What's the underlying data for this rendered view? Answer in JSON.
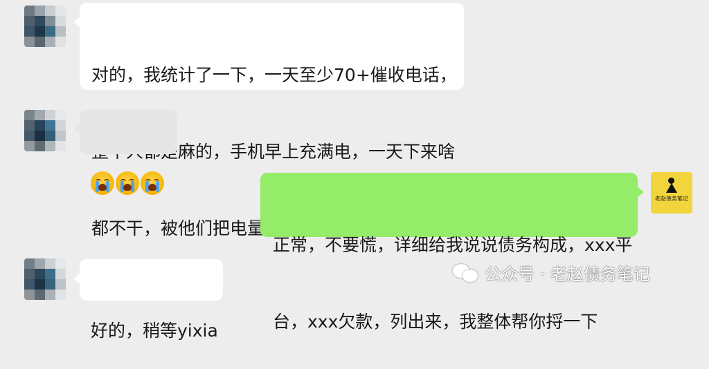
{
  "messages": [
    {
      "side": "left",
      "type": "text",
      "lines": [
        "对的，我统计了一下，一天至少70+催收电话，",
        "整个人都是麻的，手机早上充满电，一天下来啥",
        "都不干，被他们把电量打光，还要充电"
      ]
    },
    {
      "side": "left",
      "type": "emoji",
      "emojis": [
        "crying-emoji",
        "crying-emoji",
        "crying-emoji"
      ]
    },
    {
      "side": "right",
      "type": "text",
      "lines": [
        "正常，不要慌，详细给我说说债务构成，xxx平",
        "台，xxx欠款，列出来，我整体帮你捋一下"
      ]
    },
    {
      "side": "left",
      "type": "text",
      "lines": [
        "好的，稍等yixia"
      ]
    }
  ],
  "self_avatar": {
    "caption": "老赵债务笔记",
    "color": "#f2d53c"
  },
  "watermark": {
    "icon": "wechat-icon",
    "text": "公众号 · 老赵债务笔记"
  },
  "colors": {
    "background": "#ededed",
    "left_bubble": "#ffffff",
    "right_bubble": "#95ec69",
    "text": "#191919"
  }
}
